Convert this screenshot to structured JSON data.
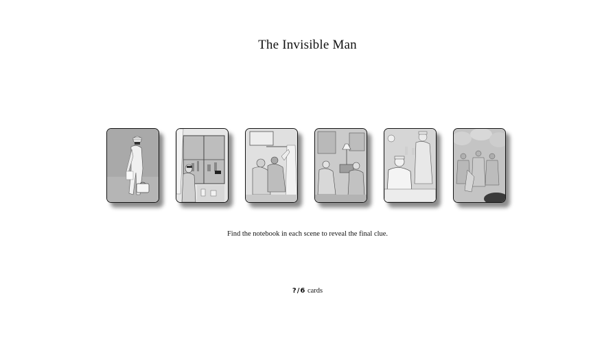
{
  "title": "The Invisible Man",
  "cards": [
    {
      "scene": "man-walking-with-briefcase-icon"
    },
    {
      "scene": "man-at-window-city-view-icon"
    },
    {
      "scene": "figures-by-curtain-icon"
    },
    {
      "scene": "people-seated-by-lamp-icon"
    },
    {
      "scene": "officers-at-table-icon"
    },
    {
      "scene": "crowd-in-foliage-icon"
    }
  ],
  "instruction": "Find the notebook in each scene to reveal the final clue.",
  "counter": {
    "count": "?/6",
    "label": "cards"
  }
}
